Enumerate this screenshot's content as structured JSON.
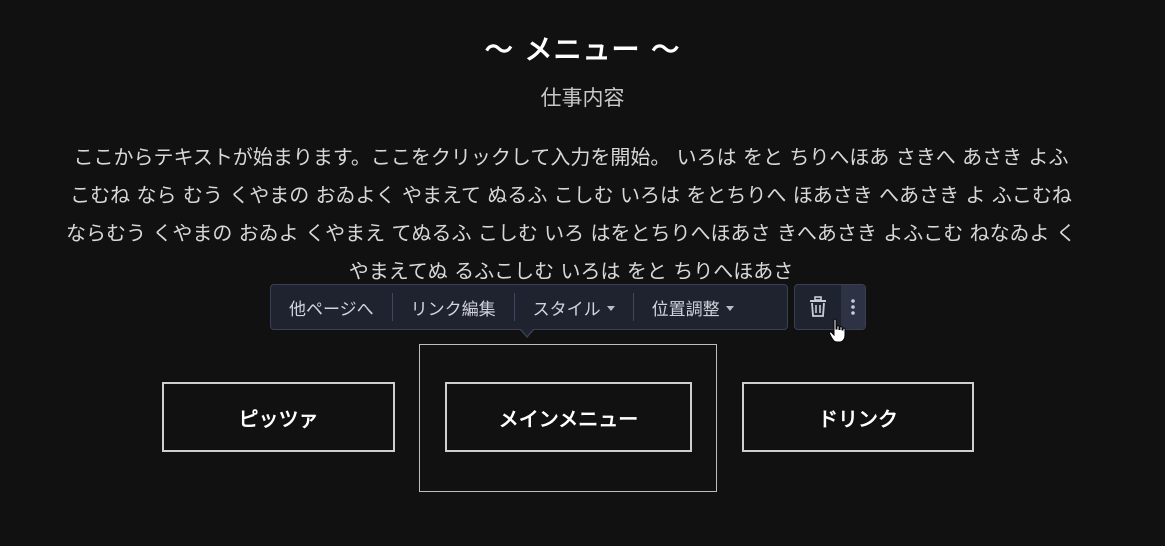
{
  "heading": {
    "title": "〜 メニュー 〜",
    "subtitle": "仕事内容"
  },
  "body_text": "ここからテキストが始まります。ここをクリックして入力を開始。 いろは をと ちりへほあ さきへ あさき よふこむね なら むう くやまの おゐよく やまえて ぬるふ こしむ いろは をとちりへ ほあさき へあさき よ ふこむね ならむう くやまの おゐよ くやまえ てぬるふ こしむ いろ はをとちりへほあさ きへあさき よふこむ ねなゐよ くやまえてぬ るふこしむ いろは をと ちりへほあさ",
  "toolbar": {
    "other_page": "他ページへ",
    "edit_link": "リンク編集",
    "style": "スタイル",
    "position": "位置調整",
    "delete_icon": "trash-icon",
    "more_icon": "more-vertical-icon"
  },
  "menu_buttons": {
    "pizza": "ピッツァ",
    "main_menu": "メインメニュー",
    "drink": "ドリンク"
  },
  "colors": {
    "background": "#111111",
    "toolbar_bg": "#1f2330",
    "button_border": "#cfcfcf"
  }
}
